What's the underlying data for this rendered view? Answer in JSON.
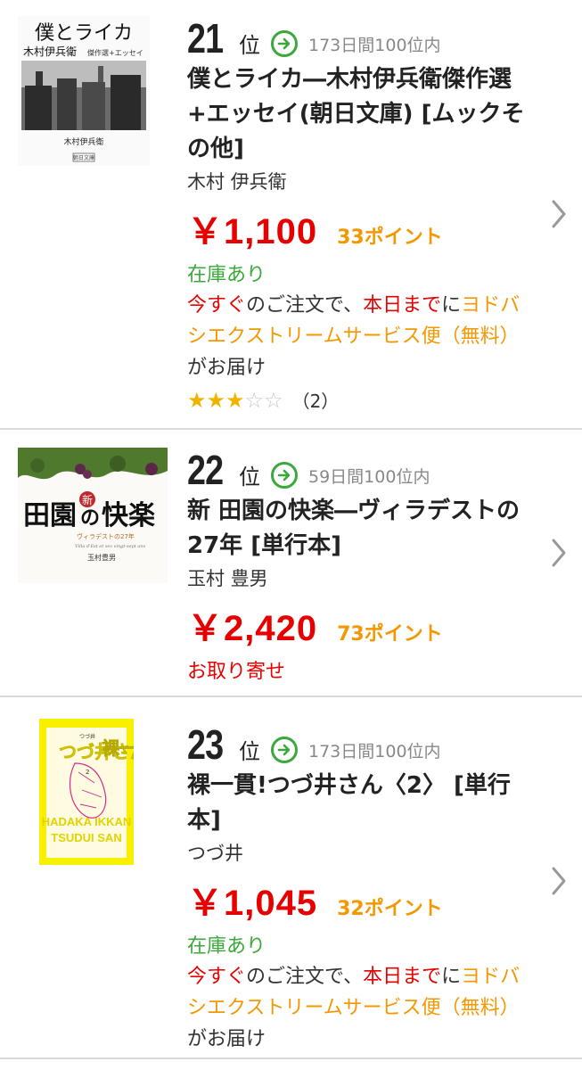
{
  "items": [
    {
      "rank": "21",
      "rank_unit": "位",
      "trend_text": "173日間100位内",
      "title": "僕とライカ―木村伊兵衛傑作選+エッセイ(朝日文庫) [ムックその他]",
      "author": "木村 伊兵衛",
      "price": "￥1,100",
      "points": "33ポイント",
      "stock": "在庫あり",
      "delivery": {
        "p1": "今すぐ",
        "p2": "のご注文で、",
        "p3": "本日まで",
        "p4": "に",
        "p5": "ヨドバシエクストリームサービス便（無料）",
        "p6": "がお届け"
      },
      "rating": {
        "stars": 3,
        "max": 5,
        "count": "（2）"
      },
      "cover": {
        "title": "僕とライカ",
        "subtitle": "木村伊兵衛",
        "tag": "傑作選+エッセイ",
        "author": "木村伊兵衛",
        "publisher": "朝日文庫"
      }
    },
    {
      "rank": "22",
      "rank_unit": "位",
      "trend_text": "59日間100位内",
      "title": "新 田園の快楽―ヴィラデストの27年 [単行本]",
      "author": "玉村 豊男",
      "price": "￥2,420",
      "points": "73ポイント",
      "stock": "お取り寄せ",
      "cover": {
        "badge": "新",
        "title_a": "田園",
        "title_b": "の",
        "title_c": "快楽",
        "subtitle": "ヴィラデストの27年",
        "latin": "Villa d'Est et ses vingt-sept ans",
        "author": "玉村豊男"
      }
    },
    {
      "rank": "23",
      "rank_unit": "位",
      "trend_text": "173日間100位内",
      "title": "裸一貫!つづ井さん〈2〉 [単行本]",
      "author": "つづ井",
      "price": "￥1,045",
      "points": "32ポイント",
      "stock": "在庫あり",
      "delivery": {
        "p1": "今すぐ",
        "p2": "のご注文で、",
        "p3": "本日まで",
        "p4": "に",
        "p5": "ヨドバシエクストリームサービス便（無料）",
        "p6": "がお届け"
      },
      "cover": {
        "title": "裸一貫!",
        "name": "つづ井さん",
        "latin1": "HADAKA IKKAN",
        "latin2": "TSUDUI SAN",
        "vol": "2"
      }
    }
  ],
  "colors": {
    "price": "#e60000",
    "points": "#f39800",
    "stock": "#3aa83a",
    "trend": "#3aa83a",
    "star_on": "#f0b400"
  }
}
